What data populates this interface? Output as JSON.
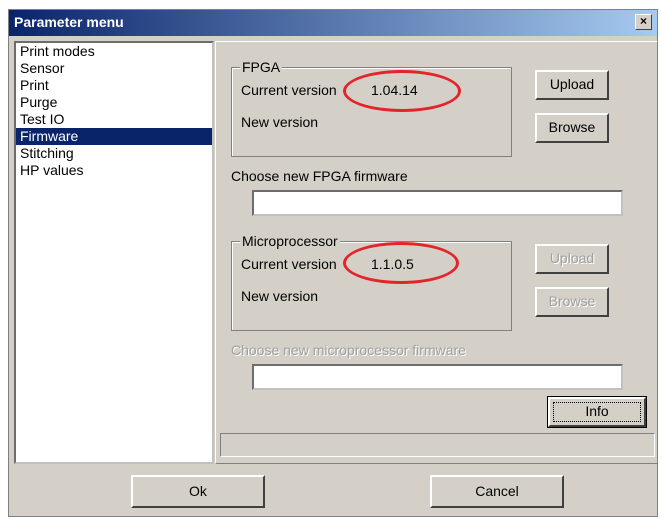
{
  "window": {
    "title": "Parameter menu",
    "close_glyph": "×"
  },
  "sidebar": {
    "items": [
      {
        "label": "Print modes"
      },
      {
        "label": "Sensor"
      },
      {
        "label": "Print"
      },
      {
        "label": "Purge"
      },
      {
        "label": "Test IO"
      },
      {
        "label": "Firmware",
        "selected": true
      },
      {
        "label": "Stitching"
      },
      {
        "label": "HP values"
      }
    ]
  },
  "fpga": {
    "legend": "FPGA",
    "current_label": "Current version",
    "current_value": "1.04.14",
    "new_label": "New version",
    "choose_label": "Choose new FPGA firmware",
    "path_value": "",
    "upload_label": "Upload",
    "browse_label": "Browse"
  },
  "micro": {
    "legend": "Microprocessor",
    "current_label": "Current version",
    "current_value": "1.1.0.5",
    "new_label": "New version",
    "choose_label": "Choose new microprocessor firmware",
    "path_value": "",
    "upload_label": "Upload",
    "browse_label": "Browse"
  },
  "info_label": "Info",
  "footer": {
    "ok_label": "Ok",
    "cancel_label": "Cancel"
  },
  "colors": {
    "annotation": "#e3242b",
    "selection": "#0a246a"
  }
}
